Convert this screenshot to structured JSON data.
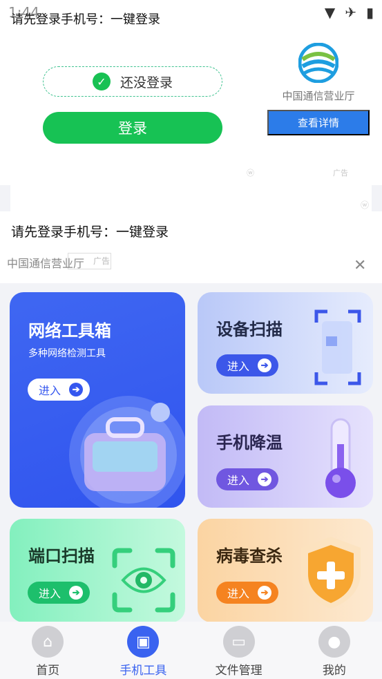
{
  "status_bar": {
    "time": "1:44"
  },
  "ad_banner": {
    "title": "请先登录手机号：一键登录",
    "status_text": "还没登录",
    "login_label": "登录",
    "brand": "中国通信营业厅",
    "detail_label": "查看详情",
    "ad_tag": "广告"
  },
  "ad_feed": {
    "title": "请先登录手机号：一键登录",
    "brand": "中国通信营业厅",
    "tag": "广告"
  },
  "tools": {
    "network": {
      "title": "网络工具箱",
      "subtitle": "多种网络检测工具",
      "enter": "进入"
    },
    "device": {
      "title": "设备扫描",
      "enter": "进入"
    },
    "cooling": {
      "title": "手机降温",
      "enter": "进入"
    },
    "port": {
      "title": "端口扫描",
      "enter": "进入"
    },
    "virus": {
      "title": "病毒查杀",
      "enter": "进入"
    }
  },
  "nav": {
    "items": [
      {
        "label": "首页",
        "icon": "home-icon"
      },
      {
        "label": "手机工具",
        "icon": "toolbox-icon"
      },
      {
        "label": "文件管理",
        "icon": "folder-icon"
      },
      {
        "label": "我的",
        "icon": "user-icon"
      }
    ],
    "active_index": 1
  },
  "colors": {
    "primary": "#3a63f0",
    "login_green": "#17c254",
    "detail_blue": "#2c7ce9"
  }
}
